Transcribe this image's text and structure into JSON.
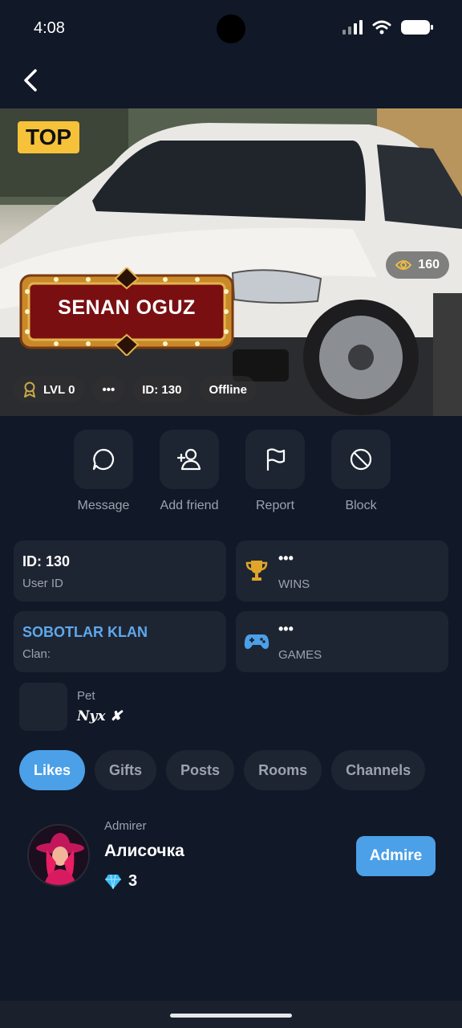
{
  "status": {
    "time": "4:08"
  },
  "profile": {
    "top_badge": "TOP",
    "views": "160",
    "name": "SENAN OGUZ",
    "chips": {
      "level": "LVL 0",
      "more": "•••",
      "id": "ID: 130",
      "status": "Offline"
    }
  },
  "actions": [
    {
      "label": "Message",
      "icon": "message-icon"
    },
    {
      "label": "Add friend",
      "icon": "add-user-icon"
    },
    {
      "label": "Report",
      "icon": "flag-icon"
    },
    {
      "label": "Block",
      "icon": "block-icon"
    }
  ],
  "cards": {
    "user_id": {
      "title": "ID: 130",
      "sub": "User ID"
    },
    "wins": {
      "title": "•••",
      "sub": "WINS",
      "icon": "trophy-icon"
    },
    "clan": {
      "title": "SOBOTLAR KLAN",
      "sub": "Clan:"
    },
    "games": {
      "title": "•••",
      "sub": "GAMES",
      "icon": "gamepad-icon"
    }
  },
  "pet": {
    "label": "Pet",
    "name": "Nyx ✘"
  },
  "tabs": [
    "Likes",
    "Gifts",
    "Posts",
    "Rooms",
    "Channels"
  ],
  "active_tab": "Likes",
  "admirer": {
    "label": "Admirer",
    "name": "Алисочка",
    "count": "3",
    "button": "Admire"
  },
  "colors": {
    "accent": "#4ba0e8",
    "background": "#111827",
    "card": "#1e2532",
    "gold": "#f5c23a"
  }
}
